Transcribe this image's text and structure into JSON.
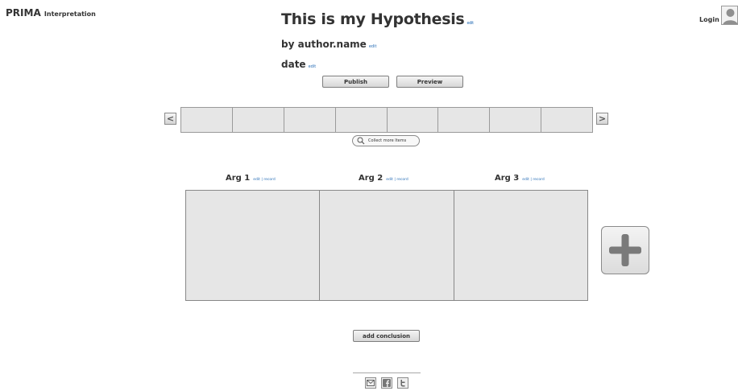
{
  "brand": {
    "name": "PRIMA",
    "sub": "Interpretation"
  },
  "auth": {
    "login_label": "Login",
    "avatar_icon": "user-avatar-icon"
  },
  "hypothesis": {
    "title": "This is my Hypothesis",
    "title_edit": "edit",
    "author": "by author.name",
    "author_edit": "edit",
    "date": "date",
    "date_edit": "edit"
  },
  "actions": {
    "publish": "Publish",
    "preview": "Preview"
  },
  "carousel": {
    "prev_label": "<",
    "next_label": ">",
    "slot_count_visible": 8,
    "collect_label": "Collect more Items",
    "collect_icon": "search-icon"
  },
  "arguments": [
    {
      "label": "Arg 1",
      "edit": "edit",
      "sep": "|",
      "record": "record"
    },
    {
      "label": "Arg 2",
      "edit": "edit",
      "sep": "|",
      "record": "record"
    },
    {
      "label": "Arg 3",
      "edit": "edit",
      "sep": "|",
      "record": "record"
    }
  ],
  "add_argument_icon": "plus-icon",
  "conclusion": {
    "label": "add conclusion"
  },
  "share": {
    "icons": [
      "email-icon",
      "facebook-icon",
      "twitter-icon"
    ]
  },
  "colors": {
    "link": "#2a6fb7",
    "panel": "#e6e6e6",
    "text": "#333333"
  }
}
